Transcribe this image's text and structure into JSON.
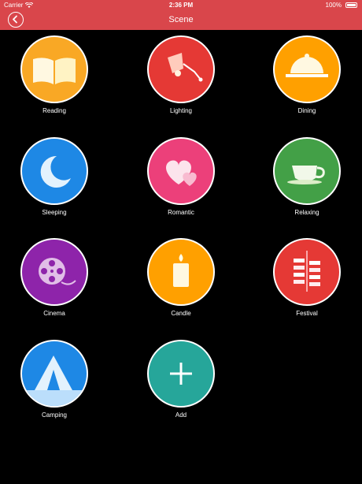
{
  "status": {
    "carrier": "Carrier",
    "time": "2:36 PM",
    "battery": "100%"
  },
  "nav": {
    "title": "Scene"
  },
  "tiles": [
    {
      "label": "Reading",
      "color": "#f9a825",
      "icon": "book-icon"
    },
    {
      "label": "Lighting",
      "color": "#e53935",
      "icon": "lamp-icon"
    },
    {
      "label": "Dining",
      "color": "#ffa000",
      "icon": "cloche-icon"
    },
    {
      "label": "Sleeping",
      "color": "#1e88e5",
      "icon": "moon-icon"
    },
    {
      "label": "Romantic",
      "color": "#ec407a",
      "icon": "hearts-icon"
    },
    {
      "label": "Relaxing",
      "color": "#43a047",
      "icon": "teacup-icon"
    },
    {
      "label": "Cinema",
      "color": "#8e24aa",
      "icon": "film-reel-icon"
    },
    {
      "label": "Candle",
      "color": "#ffa000",
      "icon": "candle-icon"
    },
    {
      "label": "Festival",
      "color": "#e53935",
      "icon": "firecracker-icon"
    },
    {
      "label": "Camping",
      "color": "#1e88e5",
      "icon": "tent-icon"
    },
    {
      "label": "Add",
      "color": "#26a69a",
      "icon": "plus-icon"
    }
  ]
}
